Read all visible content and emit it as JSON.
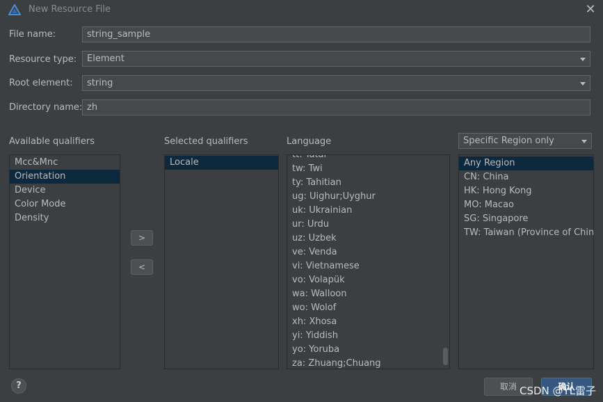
{
  "window": {
    "title": "New Resource File"
  },
  "form": {
    "file_name": {
      "label": "File name:",
      "value": "string_sample"
    },
    "resource_type": {
      "label": "Resource type:",
      "value": "Element"
    },
    "root_element": {
      "label": "Root element:",
      "value": "string"
    },
    "directory_name": {
      "label": "Directory name:",
      "value": "zh"
    }
  },
  "available": {
    "label": "Available qualifiers",
    "items": [
      "Mcc&Mnc",
      "Orientation",
      "Device",
      "Color Mode",
      "Density"
    ]
  },
  "selected": {
    "label": "Selected qualifiers",
    "items": [
      "Locale"
    ]
  },
  "transfer": {
    "add": ">",
    "remove": "<"
  },
  "language": {
    "label": "Language",
    "items": [
      "tt: Tatar",
      "tw: Twi",
      "ty: Tahitian",
      "ug: Uighur;Uyghur",
      "uk: Ukrainian",
      "ur: Urdu",
      "uz: Uzbek",
      "ve: Venda",
      "vi: Vietnamese",
      "vo: Volapük",
      "wa: Walloon",
      "wo: Wolof",
      "xh: Xhosa",
      "yi: Yiddish",
      "yo: Yoruba",
      "za: Zhuang;Chuang"
    ]
  },
  "region": {
    "filter": "Specific Region only",
    "items": [
      "Any Region",
      "CN: China",
      "HK: Hong Kong",
      "MO: Macao",
      "SG: Singapore",
      "TW: Taiwan (Province of China)"
    ]
  },
  "footer": {
    "help": "?",
    "cancel": "取消",
    "ok": "确认"
  },
  "watermark": "CSDN @YL雷子",
  "colors": {
    "background": "#3c3f41",
    "selection": "#0d293e",
    "primary_button": "#365880",
    "field": "#45494a"
  }
}
